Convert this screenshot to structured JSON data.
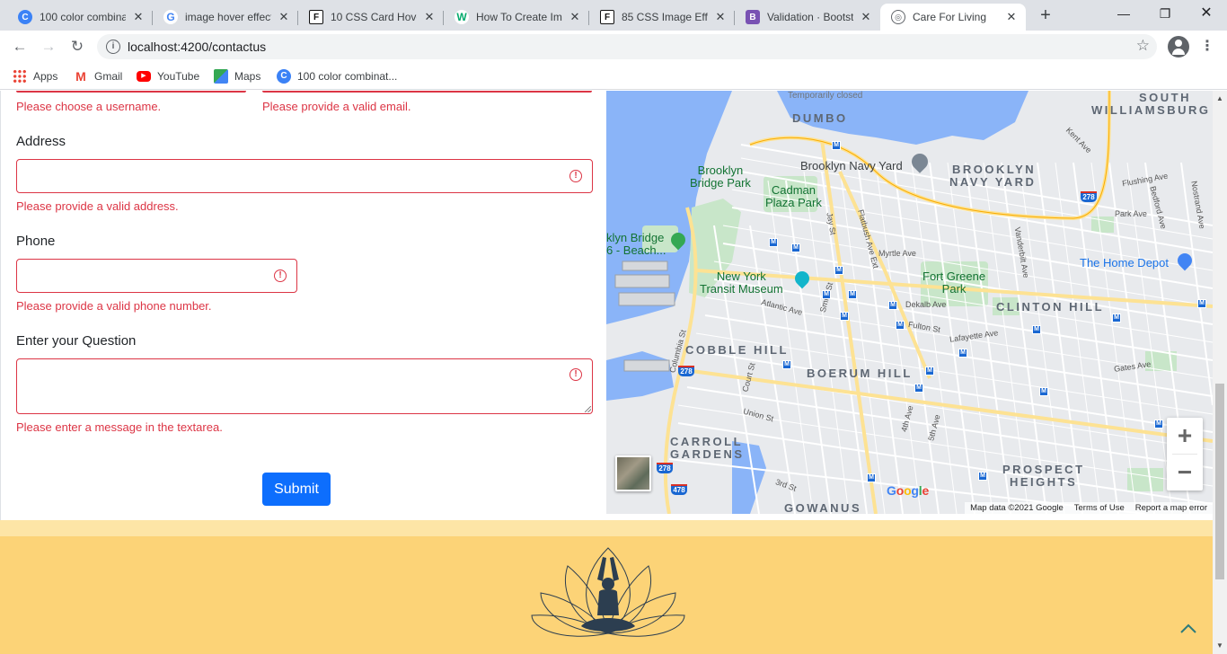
{
  "browser": {
    "tabs": [
      {
        "title": "100 color combina",
        "icon": "canva-icon",
        "active": false
      },
      {
        "title": "image hover effect",
        "icon": "google-icon",
        "active": false
      },
      {
        "title": "10 CSS Card Hover",
        "icon": "freefrontend-icon",
        "active": false
      },
      {
        "title": "How To Create Ima",
        "icon": "w3schools-icon",
        "active": false
      },
      {
        "title": "85 CSS Image Effe",
        "icon": "freefrontend-icon",
        "active": false
      },
      {
        "title": "Validation · Bootst",
        "icon": "bootstrap-icon",
        "active": false
      },
      {
        "title": "Care For Living",
        "icon": "globe-icon",
        "active": true
      }
    ],
    "url": "localhost:4200/contactus",
    "bookmarks": [
      {
        "label": "Apps",
        "icon": "apps-grid-icon"
      },
      {
        "label": "Gmail",
        "icon": "gmail-icon"
      },
      {
        "label": "YouTube",
        "icon": "youtube-icon"
      },
      {
        "label": "Maps",
        "icon": "maps-icon"
      },
      {
        "label": "100 color combinat...",
        "icon": "canva-icon"
      }
    ]
  },
  "form": {
    "username_feedback": "Please choose a username.",
    "email_feedback": "Please provide a valid email.",
    "address_label": "Address",
    "address_value": "",
    "address_feedback": "Please provide a valid address.",
    "phone_label": "Phone",
    "phone_value": "",
    "phone_feedback": "Please provide a valid phone number.",
    "question_label": "Enter your Question",
    "question_value": "",
    "question_feedback": "Please enter a message in the textarea.",
    "submit_label": "Submit"
  },
  "map": {
    "areas": [
      "DUMBO",
      "SOUTH",
      "WILLIAMSBURG",
      "BROOKLYN",
      "NAVY YARD",
      "CLINTON HILL",
      "COBBLE HILL",
      "BOERUM HILL",
      "CARROLL",
      "GARDENS",
      "PROSPECT",
      "HEIGHTS",
      "GOWANUS"
    ],
    "pois": {
      "brooklyn_bridge_park": "Brooklyn\nBridge Park",
      "cadman_plaza_park": "Cadman\nPlaza Park",
      "navy_yard": "Brooklyn Navy Yard",
      "bridge_park_beach": "klyn Bridge\n6 - Beach...",
      "transit_museum": "New York\nTransit Museum",
      "fort_greene_park": "Fort Greene\nPark",
      "home_depot": "The Home Depot",
      "temporarily_closed": "Temporarily closed"
    },
    "streets": [
      "Kent Ave",
      "Flushing Ave",
      "Bedford Ave",
      "Park Ave",
      "Nostrand Ave",
      "Myrtle Ave",
      "Dekalb Ave",
      "Fulton St",
      "Lafayette Ave",
      "Atlantic Ave",
      "Gates Ave",
      "Union St",
      "Court St",
      "Columbia St",
      "Jay St",
      "Smith St",
      "Flatbush Ave Ext",
      "Vanderbilt Ave",
      "4th Ave",
      "5th Ave",
      "3rd St"
    ],
    "highway_shields": [
      "278",
      "278",
      "278",
      "478"
    ],
    "google_logo": "Google",
    "attribution": [
      "Map data ©2021 Google",
      "Terms of Use",
      "Report a map error"
    ],
    "zoom_in": "+",
    "zoom_out": "−"
  },
  "colors": {
    "invalid": "#dc3545",
    "primary": "#0d6efd",
    "footer": "#fcd377",
    "footer_stripe": "#fde5a6",
    "logo": "#2c3e50"
  }
}
